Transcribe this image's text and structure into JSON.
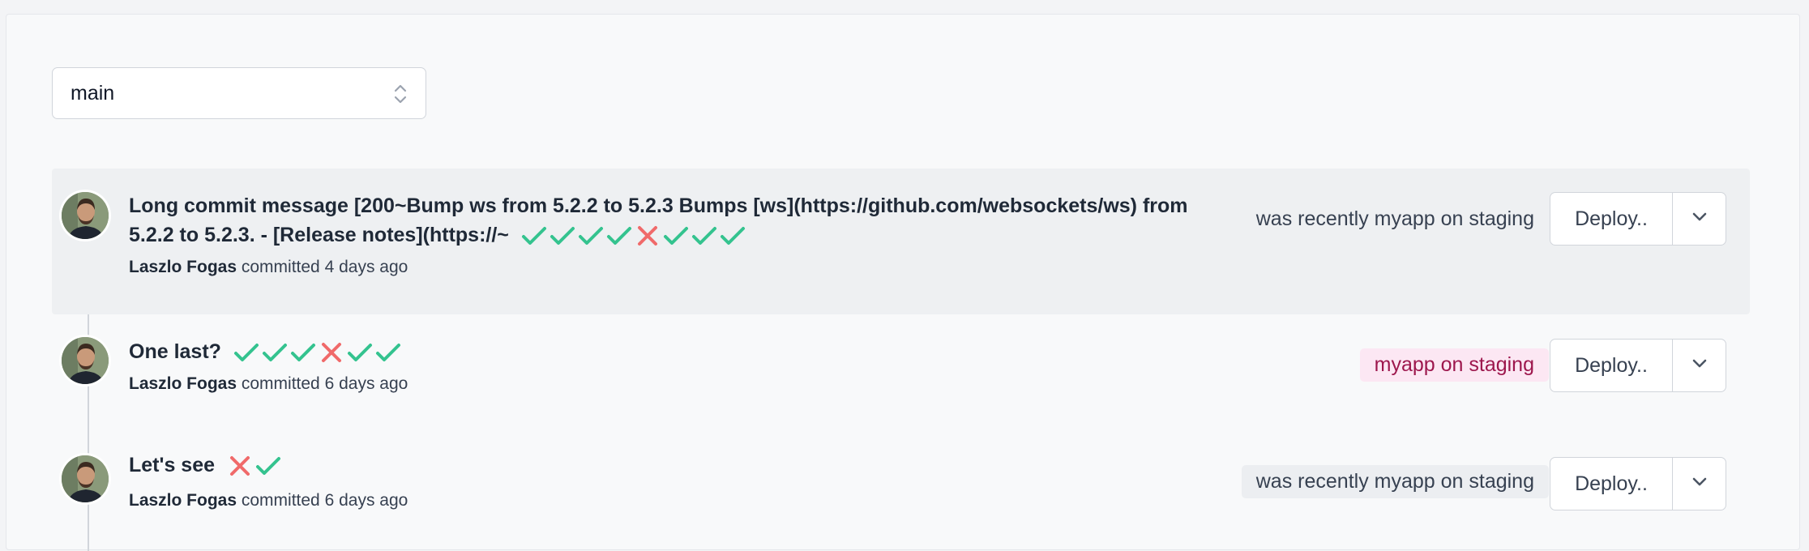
{
  "branch_select": {
    "value": "main"
  },
  "colors": {
    "success": "#34c38f",
    "failure": "#f06a6a",
    "accent_pink": "#fce7f3"
  },
  "commits": [
    {
      "title": "Long commit message [200~Bump ws from 5.2.2 to 5.2.3 Bumps [ws](https://github.com/websockets/ws) from 5.2.2 to 5.2.3. - [Release notes](https://~",
      "author": "Laszlo Fogas",
      "committed_text": "committed",
      "time_ago": "4 days ago",
      "checks": [
        "success",
        "success",
        "success",
        "success",
        "failure",
        "success",
        "success",
        "success"
      ],
      "status_text": "was recently myapp on staging",
      "status_style": "plain",
      "deploy_label": "Deploy..",
      "highlighted": true
    },
    {
      "title": "One last?",
      "author": "Laszlo Fogas",
      "committed_text": "committed",
      "time_ago": "6 days ago",
      "checks": [
        "success",
        "success",
        "success",
        "failure",
        "success",
        "success"
      ],
      "status_text": "myapp on staging",
      "status_style": "pink",
      "deploy_label": "Deploy..",
      "highlighted": false
    },
    {
      "title": "Let's see",
      "author": "Laszlo Fogas",
      "committed_text": "committed",
      "time_ago": "6 days ago",
      "checks": [
        "failure",
        "success"
      ],
      "status_text": "was recently myapp on staging",
      "status_style": "gray",
      "deploy_label": "Deploy..",
      "highlighted": false
    }
  ]
}
